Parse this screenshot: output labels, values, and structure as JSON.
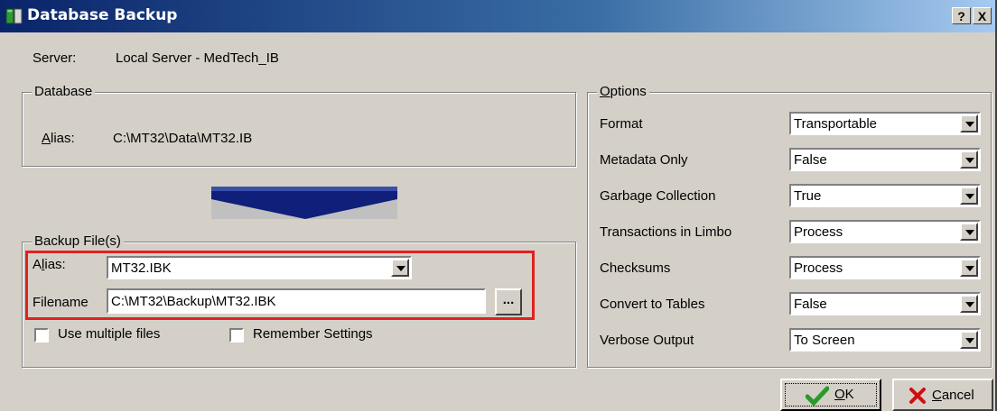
{
  "window": {
    "title": "Database Backup",
    "help_label": "?",
    "close_label": "X"
  },
  "server": {
    "label": "Server:",
    "value": "Local Server - MedTech_IB"
  },
  "database": {
    "group_label": "Database",
    "alias_label": "Alias:",
    "alias_value": "C:\\MT32\\Data\\MT32.IB"
  },
  "arrow": {
    "icon": "down-arrow-icon",
    "color": "#0f1f7a"
  },
  "backup": {
    "group_label": "Backup File(s)",
    "alias_label": "Alias:",
    "alias_value": "MT32.IBK",
    "filename_label": "Filename",
    "filename_value": "C:\\MT32\\Backup\\MT32.IBK",
    "browse_label": "...",
    "use_multiple_label": "Use multiple files",
    "use_multiple_checked": false,
    "remember_label": "Remember Settings",
    "remember_checked": false
  },
  "options": {
    "group_label": "Options",
    "rows": [
      {
        "label": "Format",
        "value": "Transportable"
      },
      {
        "label": "Metadata Only",
        "value": "False"
      },
      {
        "label": "Garbage Collection",
        "value": "True"
      },
      {
        "label": "Transactions in Limbo",
        "value": "Process"
      },
      {
        "label": "Checksums",
        "value": "Process"
      },
      {
        "label": "Convert to Tables",
        "value": "False"
      },
      {
        "label": "Verbose Output",
        "value": "To Screen"
      }
    ]
  },
  "buttons": {
    "ok_label": "OK",
    "cancel_label": "Cancel"
  },
  "colors": {
    "highlight": "#e02020",
    "titlebar": "#0a246a",
    "ok_check": "#2a9a2a",
    "cancel_x": "#cc1010"
  }
}
